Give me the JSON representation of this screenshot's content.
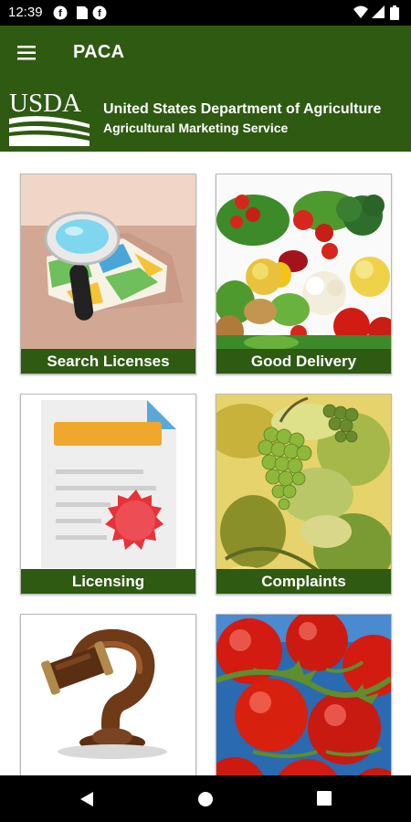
{
  "status_bar": {
    "time": "12:39",
    "left_icons": [
      "f-icon",
      "sd-card-icon",
      "f-icon"
    ],
    "right_icons": [
      "wifi-icon",
      "signal-icon",
      "battery-icon"
    ]
  },
  "app_bar": {
    "title": "PACA",
    "menu_icon": "hamburger-menu-icon"
  },
  "agency": {
    "logo_text": "USDA",
    "line1": "United States Department of Agriculture",
    "line2": "Agricultural Marketing Service"
  },
  "tiles": [
    {
      "label": "Search Licenses",
      "icon": "magnifier-map-icon"
    },
    {
      "label": "Good Delivery",
      "icon": "vegetables-image"
    },
    {
      "label": "Licensing",
      "icon": "certificate-icon"
    },
    {
      "label": "Complaints",
      "icon": "grapes-image"
    },
    {
      "label": "",
      "icon": "gavel-question-icon"
    },
    {
      "label": "",
      "icon": "tomatoes-image"
    }
  ],
  "nav_bar": {
    "buttons": [
      "back-icon",
      "home-icon",
      "recents-icon"
    ]
  },
  "colors": {
    "brand_green": "#2e5a12",
    "status_bar": "#000000"
  }
}
